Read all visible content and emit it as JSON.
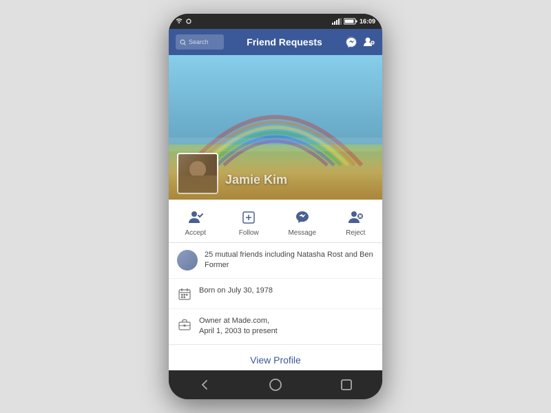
{
  "phone": {
    "status_bar": {
      "time": "16:09",
      "battery": "▮▮▮▮",
      "signal": "▲▲▲"
    },
    "header": {
      "search_placeholder": "Search",
      "title": "Friend Requests",
      "icon_messages": "💬",
      "icon_people": "👥"
    },
    "profile": {
      "name": "Jamie Kim",
      "cover_alt": "Countryside landscape with rainbow"
    },
    "actions": [
      {
        "id": "accept",
        "label": "Accept",
        "icon": "accept"
      },
      {
        "id": "follow",
        "label": "Follow",
        "icon": "follow"
      },
      {
        "id": "message",
        "label": "Message",
        "icon": "message"
      },
      {
        "id": "reject",
        "label": "Reject",
        "icon": "reject"
      }
    ],
    "info": [
      {
        "id": "mutual-friends",
        "text": "25 mutual friends including Natasha Rost and Ben Former",
        "icon": "people"
      },
      {
        "id": "birthday",
        "text": "Born on July 30, 1978",
        "icon": "calendar"
      },
      {
        "id": "work",
        "text": "Owner at Made.com,\nApril 1, 2003 to present",
        "icon": "briefcase"
      }
    ],
    "view_profile": "View Profile",
    "bottom_nav": {
      "back": "◁",
      "home": "○",
      "recents": "□"
    }
  }
}
